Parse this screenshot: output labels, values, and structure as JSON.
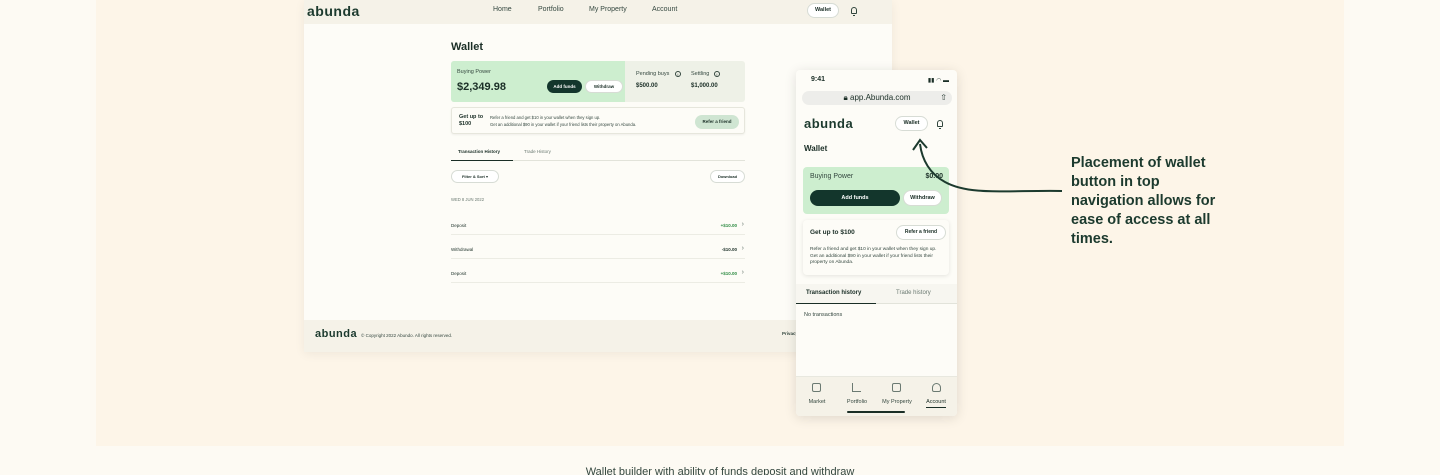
{
  "desktop": {
    "logo": "abunda",
    "nav": [
      "Home",
      "Portfolio",
      "My Property",
      "Account"
    ],
    "wallet_button": "Wallet",
    "title": "Wallet",
    "buying_power_label": "Buying Power",
    "buying_power_value": "$2,349.98",
    "add_funds": "Add funds",
    "withdraw": "Withdraw",
    "pending_buys_label": "Pending buys",
    "pending_buys_value": "$500.00",
    "settling_label": "Settling",
    "settling_value": "$1,000.00",
    "referral_title": "Get up to $100",
    "referral_line1": "Refer a friend and get $10 in your wallet when they sign up.",
    "referral_line2": "Get an additional $90 in your wallet if your friend lists their property on Abunda.",
    "refer_button": "Refer a friend",
    "tabs": [
      "Transaction History",
      "Trade History"
    ],
    "filter_button": "Filter & Sort",
    "download_button": "Download",
    "date_header": "WED 8 JUN 2022",
    "transactions": [
      {
        "label": "Deposit",
        "amount": "+$10.00"
      },
      {
        "label": "Withdrawal",
        "amount": "-$10.00"
      },
      {
        "label": "Deposit",
        "amount": "+$10.00"
      }
    ],
    "footer_logo": "abunda",
    "footer_copyright": "© Copyright 2022 Abundo. All rights reserved.",
    "footer_link": "Privacy"
  },
  "mobile": {
    "time": "9:41",
    "url": "app.Abunda.com",
    "logo": "abunda",
    "wallet_button": "Wallet",
    "title": "Wallet",
    "buying_power_label": "Buying Power",
    "buying_power_value": "$0.00",
    "add_funds": "Add funds",
    "withdraw": "Withdraw",
    "referral_title": "Get up to $100",
    "refer_button": "Refer a friend",
    "referral_text": "Refer a friend and get $10 in your wallet when they sign up. Get an additional $90 in your wallet if your friend lists their property on Abunda.",
    "tabs": [
      "Transaction history",
      "Trade history"
    ],
    "empty_state": "No transactions",
    "bottom_nav": [
      "Market",
      "Portfolio",
      "My Property",
      "Account"
    ]
  },
  "callout": "Placement of wallet button in top navigation allows for ease of access at all times.",
  "caption": "Wallet builder with ability of funds deposit and withdraw"
}
